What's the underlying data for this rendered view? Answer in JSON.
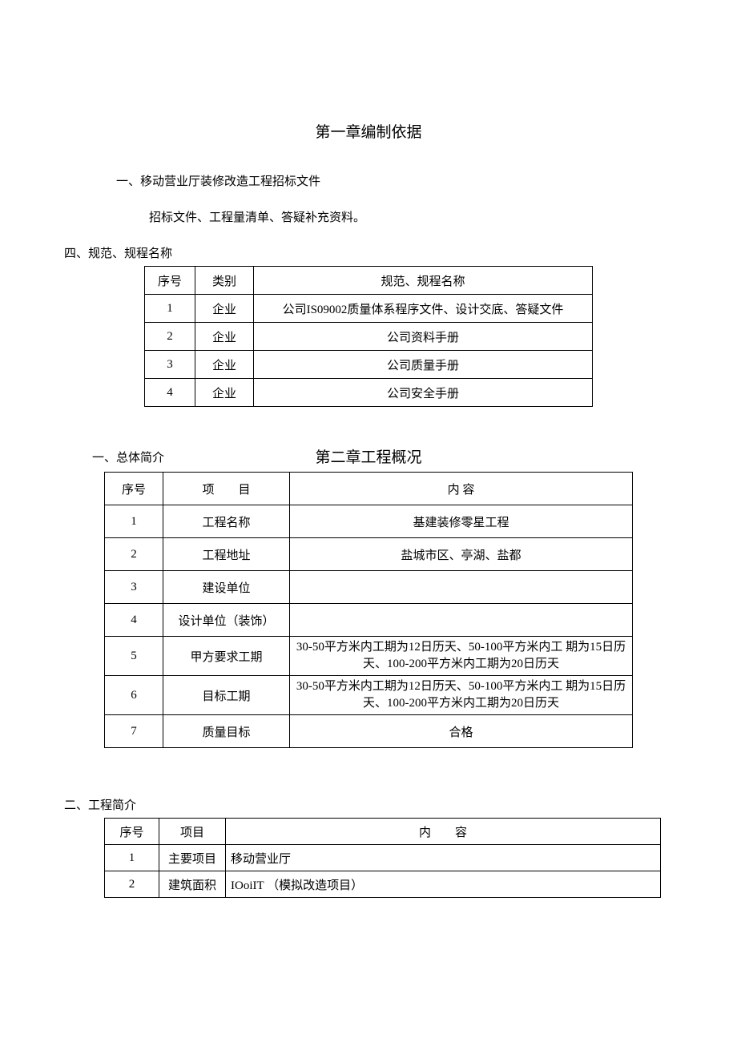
{
  "chapter1": {
    "title": "第一章编制依据",
    "line1": "一、移动营业厅装修改造工程招标文件",
    "line2": "招标文件、工程量清单、答疑补充资料。",
    "section4_label": "四、规范、规程名称",
    "table": {
      "headers": {
        "seq": "序号",
        "cat": "类别",
        "name": "规范、规程名称"
      },
      "rows": [
        {
          "seq": "1",
          "cat": "企业",
          "name": "公司IS09002质量体系程序文件、设计交底、答疑文件"
        },
        {
          "seq": "2",
          "cat": "企业",
          "name": "公司资料手册"
        },
        {
          "seq": "3",
          "cat": "企业",
          "name": "公司质量手册"
        },
        {
          "seq": "4",
          "cat": "企业",
          "name": "公司安全手册"
        }
      ]
    }
  },
  "chapter2": {
    "title": "第二章工程概况",
    "overview_label": "一、总体简介",
    "table": {
      "headers": {
        "seq": "序号",
        "item": "项　　目",
        "content": "内 容"
      },
      "rows": [
        {
          "seq": "1",
          "item": "工程名称",
          "content": "基建装修零星工程"
        },
        {
          "seq": "2",
          "item": "工程地址",
          "content": "盐城市区、亭湖、盐都"
        },
        {
          "seq": "3",
          "item": "建设单位",
          "content": ""
        },
        {
          "seq": "4",
          "item": "设计单位（装饰）",
          "content": ""
        },
        {
          "seq": "5",
          "item": "甲方要求工期",
          "content": "30-50平方米内工期为12日历天、50-100平方米内工 期为15日历天、100-200平方米内工期为20日历天"
        },
        {
          "seq": "6",
          "item": "目标工期",
          "content": "30-50平方米内工期为12日历天、50-100平方米内工 期为15日历天、100-200平方米内工期为20日历天"
        },
        {
          "seq": "7",
          "item": "质量目标",
          "content": "合格"
        }
      ]
    },
    "project_label": "二、工程简介",
    "table2": {
      "headers": {
        "seq": "序号",
        "item": "项目",
        "content": "内　　容"
      },
      "rows": [
        {
          "seq": "1",
          "item": "主要项目",
          "content": "移动营业厅"
        },
        {
          "seq": "2",
          "item": "建筑面积",
          "content": "IOoiIT （模拟改造项目）"
        }
      ]
    }
  }
}
